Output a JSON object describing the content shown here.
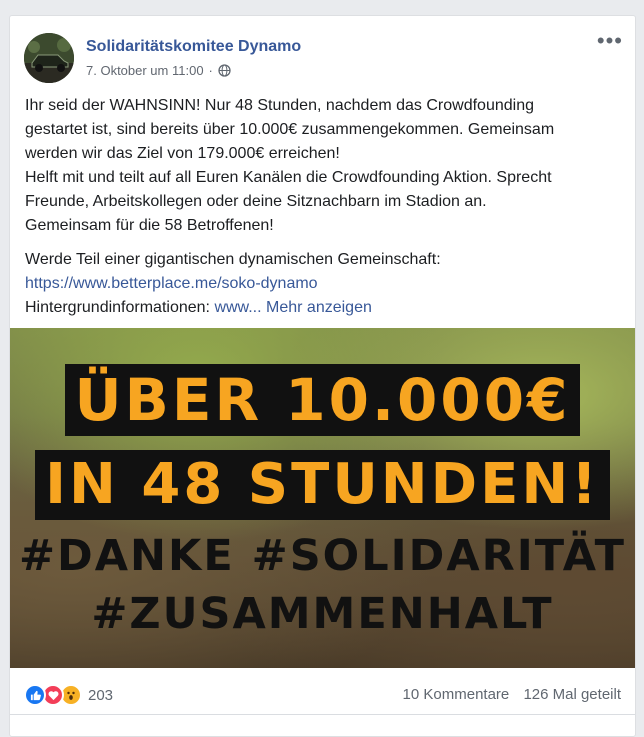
{
  "post": {
    "author": "Solidaritätskomitee Dynamo",
    "timestamp": "7. Oktober um 11:00",
    "separator": "·",
    "privacy_icon": "globe-icon",
    "more_icon": "more-options-icon",
    "more_label": "•••",
    "text_lines_p1": [
      "Ihr seid der WAHNSINN! Nur 48 Stunden, nachdem das Crowdfounding",
      "gestartet ist, sind bereits über 10.000€ zusammengekommen. Gemeinsam",
      "werden wir das Ziel von 179.000€ erreichen!",
      "Helft mit und teilt auf all Euren Kanälen die Crowdfounding Aktion. Sprecht",
      "Freunde, Arbeitskollegen oder deine Sitznachbarn im Stadion an.",
      "Gemeinsam für die 58 Betroffenen!"
    ],
    "p2_line1": "Werde Teil einer gigantischen dynamischen Gemeinschaft:",
    "p2_link": "https://www.betterplace.me/soko-dynamo",
    "p2_line3_prefix": "Hintergrundinformationen: ",
    "p2_line3_link": "www...",
    "see_more": "Mehr anzeigen"
  },
  "banner": {
    "line1": "ÜBER 10.000€",
    "line2": "IN 48 STUNDEN!",
    "line3": "#DANKE #SOLIDARITÄT",
    "line4": "#ZUSAMMENHALT",
    "accent_color": "#f7a521"
  },
  "footer": {
    "reaction_icons": [
      "like-icon",
      "love-icon",
      "wow-icon"
    ],
    "reaction_count": "203",
    "comments": "10 Kommentare",
    "shares": "126 Mal geteilt"
  },
  "colors": {
    "link": "#385898",
    "background": "#e9ebee",
    "text": "#1c1e21",
    "meta": "#616770"
  }
}
